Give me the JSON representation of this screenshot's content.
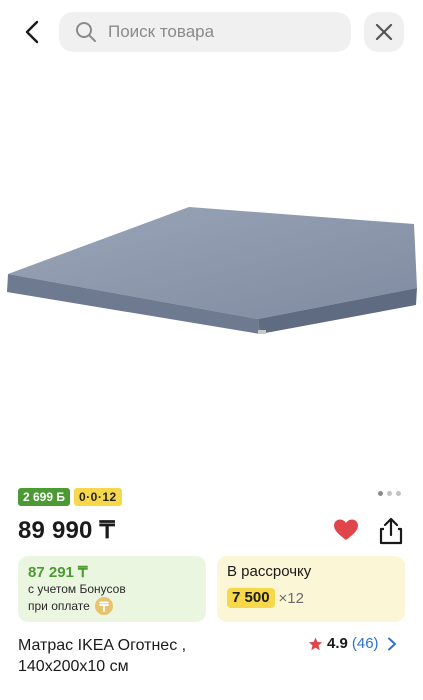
{
  "header": {
    "search_placeholder": "Поиск товара"
  },
  "product": {
    "badges": {
      "bonus": "2 699 Б",
      "installment": "0·0·12"
    },
    "gallery": {
      "dot_count": 3,
      "active_index": 0
    },
    "price": "89 990 ₸",
    "is_favorite": true,
    "bonus_card": {
      "amount": "87 291 ₸",
      "line1": "с учетом Бонусов",
      "line2": "при оплате"
    },
    "installment_card": {
      "title": "В рассрочку",
      "monthly": "7 500",
      "months": "×12"
    },
    "name_line1": "Матрас IKEA Оготнес ,",
    "name_line2": "140x200x10 см",
    "rating": "4.9",
    "reviews": "(46)"
  },
  "colors": {
    "green": "#4c9a33",
    "yellow": "#f6d84a",
    "heart": "#e0454a",
    "link": "#2e6fd8"
  },
  "icons": [
    "back-arrow-icon",
    "search-icon",
    "close-icon",
    "heart-icon",
    "share-icon",
    "star-icon",
    "chevron-right-icon",
    "tenge-coin-icon"
  ]
}
